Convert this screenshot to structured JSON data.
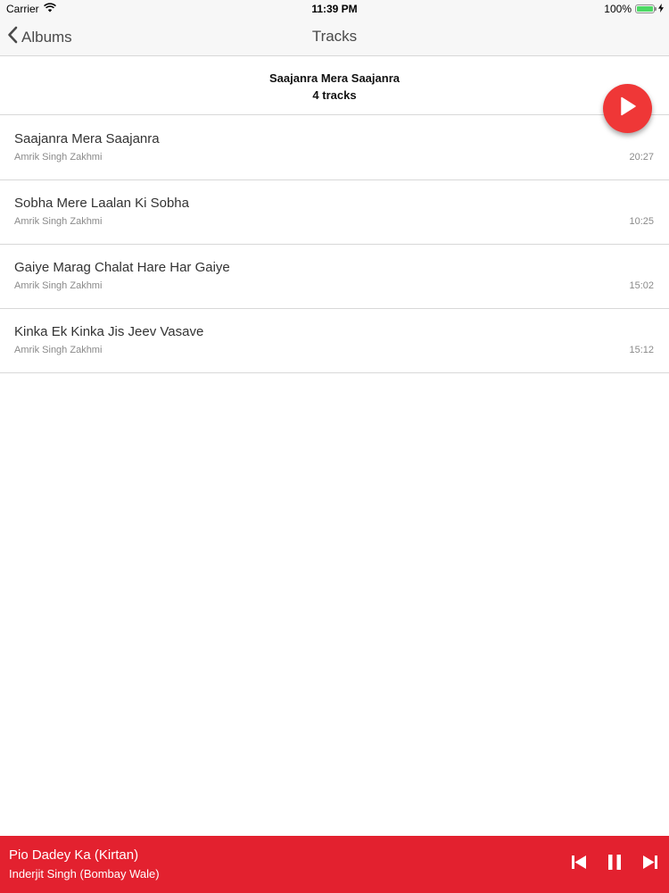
{
  "status_bar": {
    "carrier": "Carrier",
    "time": "11:39 PM",
    "battery": "100%",
    "battery_level": 1.0
  },
  "nav": {
    "back_label": "Albums",
    "title": "Tracks"
  },
  "album": {
    "title": "Saajanra Mera Saajanra",
    "track_count": "4 tracks"
  },
  "tracks": [
    {
      "title": "Saajanra Mera Saajanra",
      "artist": "Amrik Singh Zakhmi",
      "duration": "20:27"
    },
    {
      "title": "Sobha Mere Laalan Ki Sobha",
      "artist": "Amrik Singh Zakhmi",
      "duration": "10:25"
    },
    {
      "title": "Gaiye Marag Chalat Hare Har Gaiye",
      "artist": "Amrik Singh Zakhmi",
      "duration": "15:02"
    },
    {
      "title": "Kinka Ek Kinka Jis Jeev Vasave",
      "artist": "Amrik Singh Zakhmi",
      "duration": "15:12"
    }
  ],
  "now_playing": {
    "title": "Pio Dadey Ka (Kirtan)",
    "artist": "Inderjit Singh (Bombay Wale)"
  },
  "icons": {
    "back": "chevron-left-icon",
    "play": "play-icon",
    "previous": "skip-previous-icon",
    "pause": "pause-icon",
    "next": "skip-next-icon"
  },
  "colors": {
    "accent": "#e3212f",
    "fab": "#ef3737",
    "battery": "#4cd964"
  }
}
